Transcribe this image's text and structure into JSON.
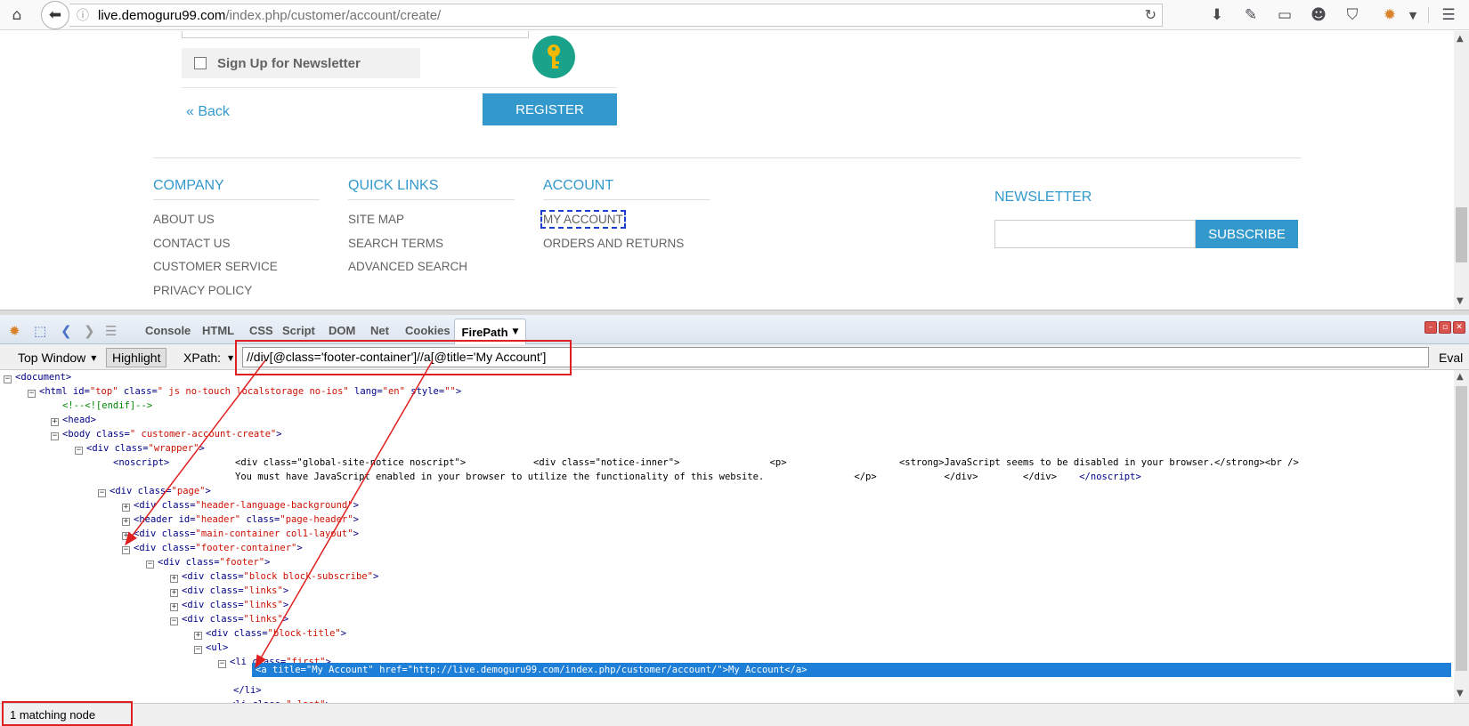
{
  "browser": {
    "url_host": "live.demoguru99.com",
    "url_path": "/index.php/customer/account/create/"
  },
  "page": {
    "newsletter_label": "Sign Up for Newsletter",
    "back_link": "« Back",
    "register_button": "REGISTER",
    "footer": {
      "company": {
        "title": "COMPANY",
        "items": [
          "ABOUT US",
          "CONTACT US",
          "CUSTOMER SERVICE",
          "PRIVACY POLICY"
        ]
      },
      "quick_links": {
        "title": "QUICK LINKS",
        "items": [
          "SITE MAP",
          "SEARCH TERMS",
          "ADVANCED SEARCH"
        ]
      },
      "account": {
        "title": "ACCOUNT",
        "items": [
          "MY ACCOUNT",
          "ORDERS AND RETURNS"
        ]
      },
      "newsletter": {
        "title": "NEWSLETTER",
        "subscribe_button": "SUBSCRIBE"
      }
    }
  },
  "firebug": {
    "tabs": [
      "Console",
      "HTML",
      "CSS",
      "Script",
      "DOM",
      "Net",
      "Cookies"
    ],
    "active_tab": "FirePath",
    "toolbar": {
      "window_select": "Top Window",
      "highlight": "Highlight",
      "xpath_label": "XPath:",
      "xpath_value": "//div[@class='footer-container']//a[@title='My Account']",
      "eval": "Eval"
    },
    "tree": {
      "document": "<document>",
      "html_tag": "<html id=",
      "html_id": "\"top\"",
      "html_class_attr": " class=",
      "html_class": "\" js no-touch localstorage no-ios\"",
      "html_lang_attr": " lang=",
      "html_lang": "\"en\"",
      "html_style_attr": " style=",
      "html_style": "\"\"",
      "comment": "<!--<![endif]-->",
      "head": "<head>",
      "body_tag": "<body class=",
      "body_class": "\" customer-account-create\"",
      "wrapper_tag": "<div class=",
      "wrapper_class": "\"wrapper\"",
      "noscript_open": "<noscript>",
      "noscript_line1": "<div class=\"global-site-notice noscript\">            <div class=\"notice-inner\">                <p>                    <strong>JavaScript seems to be disabled in your browser.</strong><br />",
      "noscript_line2": "You must have JavaScript enabled in your browser to utilize the functionality of this website.                </p>            </div>        </div>    ",
      "noscript_close": "</noscript>",
      "page_class": "\"page\"",
      "header_lang_class": "\"header-language-background\"",
      "header_tag": "<header id=",
      "header_id": "\"header\"",
      "header_class_attr": " class=",
      "header_class": "\"page-header\"",
      "main_class": "\"main-container col1-layout\"",
      "footer_container_class": "\"footer-container\"",
      "footer_class": "\"footer\"",
      "block_subscribe_class": "\"block block-subscribe\"",
      "links_class": "\"links\"",
      "block_title_class": "\"block-title\"",
      "ul": "<ul>",
      "li_tag": "<li class=",
      "li_first_class": "\"first\"",
      "selected_node": "<a title=\"My Account\" href=\"http://live.demoguru99.com/index.php/customer/account/\">My Account</a>",
      "li_close": "</li>",
      "li_last_class": "\" last\"",
      "gt": ">"
    },
    "status": "1 matching node"
  },
  "colors": {
    "accent": "#3399cc",
    "highlight": "#1e7fd8",
    "annotation_red": "#e02020"
  }
}
